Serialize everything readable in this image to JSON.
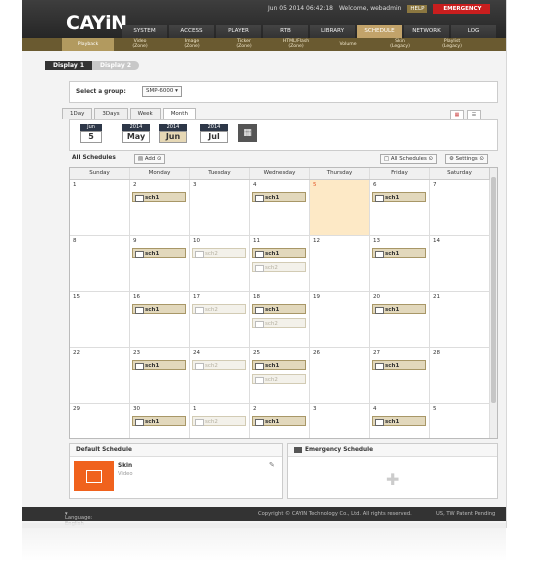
{
  "status": {
    "datetime": "Jun 05 2014 06:42:18",
    "welcome": "Welcome, webadmin",
    "help": "HELP",
    "emergency": "EMERGENCY"
  },
  "logo": "CAYiN",
  "main_nav": [
    "SYSTEM",
    "ACCESS",
    "PLAYER",
    "RTB",
    "LIBRARY",
    "SCHEDULE",
    "NETWORK",
    "LOG"
  ],
  "sub_nav": [
    {
      "line1": "Playback",
      "line2": ""
    },
    {
      "line1": "Video",
      "line2": "(Zone)"
    },
    {
      "line1": "Image",
      "line2": "(Zone)"
    },
    {
      "line1": "Ticker",
      "line2": "(Zone)"
    },
    {
      "line1": "HTML/Flash",
      "line2": "(Zone)"
    },
    {
      "line1": "Volume",
      "line2": ""
    },
    {
      "line1": "Skin",
      "line2": "(Legacy)"
    },
    {
      "line1": "Playlist",
      "line2": "(Legacy)"
    }
  ],
  "displays": [
    "Display 1",
    "Display 2"
  ],
  "group": {
    "label": "Select a group:",
    "value": "SMP-6000"
  },
  "view_tabs": [
    "1Day",
    "3Days",
    "Week",
    "Month"
  ],
  "date": {
    "month_label": "Jun",
    "day": "5",
    "years": [
      "2014",
      "2014",
      "2014"
    ],
    "months": [
      "May",
      "Jun",
      "Jul"
    ]
  },
  "schedules_bar": {
    "title": "All Schedules",
    "add": "Add",
    "all_schedules": "All Schedules",
    "settings": "Settings"
  },
  "weekdays": [
    "Sunday",
    "Monday",
    "Tuesday",
    "Wednesday",
    "Thursday",
    "Friday",
    "Saturday"
  ],
  "weeks": [
    [
      {
        "d": "1",
        "e": []
      },
      {
        "d": "2",
        "e": [
          {
            "n": "sch1",
            "dim": false
          }
        ]
      },
      {
        "d": "3",
        "e": []
      },
      {
        "d": "4",
        "e": [
          {
            "n": "sch1",
            "dim": false
          }
        ]
      },
      {
        "d": "5",
        "e": [],
        "today": true
      },
      {
        "d": "6",
        "e": [
          {
            "n": "sch1",
            "dim": false
          }
        ]
      },
      {
        "d": "7",
        "e": []
      }
    ],
    [
      {
        "d": "8",
        "e": []
      },
      {
        "d": "9",
        "e": [
          {
            "n": "sch1",
            "dim": false
          }
        ]
      },
      {
        "d": "10",
        "e": [
          {
            "n": "sch2",
            "dim": true
          }
        ]
      },
      {
        "d": "11",
        "e": [
          {
            "n": "sch1",
            "dim": false
          },
          {
            "n": "sch2",
            "dim": true
          }
        ]
      },
      {
        "d": "12",
        "e": []
      },
      {
        "d": "13",
        "e": [
          {
            "n": "sch1",
            "dim": false
          }
        ]
      },
      {
        "d": "14",
        "e": []
      }
    ],
    [
      {
        "d": "15",
        "e": []
      },
      {
        "d": "16",
        "e": [
          {
            "n": "sch1",
            "dim": false
          }
        ]
      },
      {
        "d": "17",
        "e": [
          {
            "n": "sch2",
            "dim": true
          }
        ]
      },
      {
        "d": "18",
        "e": [
          {
            "n": "sch1",
            "dim": false
          },
          {
            "n": "sch2",
            "dim": true
          }
        ]
      },
      {
        "d": "19",
        "e": []
      },
      {
        "d": "20",
        "e": [
          {
            "n": "sch1",
            "dim": false
          }
        ]
      },
      {
        "d": "21",
        "e": []
      }
    ],
    [
      {
        "d": "22",
        "e": []
      },
      {
        "d": "23",
        "e": [
          {
            "n": "sch1",
            "dim": false
          }
        ]
      },
      {
        "d": "24",
        "e": [
          {
            "n": "sch2",
            "dim": true
          }
        ]
      },
      {
        "d": "25",
        "e": [
          {
            "n": "sch1",
            "dim": false
          },
          {
            "n": "sch2",
            "dim": true
          }
        ]
      },
      {
        "d": "26",
        "e": []
      },
      {
        "d": "27",
        "e": [
          {
            "n": "sch1",
            "dim": false
          }
        ]
      },
      {
        "d": "28",
        "e": []
      }
    ],
    [
      {
        "d": "29",
        "e": []
      },
      {
        "d": "30",
        "e": [
          {
            "n": "sch1",
            "dim": false
          }
        ]
      },
      {
        "d": "1",
        "e": [
          {
            "n": "sch2",
            "dim": true
          }
        ]
      },
      {
        "d": "2",
        "e": [
          {
            "n": "sch1",
            "dim": false
          }
        ]
      },
      {
        "d": "3",
        "e": []
      },
      {
        "d": "4",
        "e": [
          {
            "n": "sch1",
            "dim": false
          }
        ]
      },
      {
        "d": "5",
        "e": []
      }
    ]
  ],
  "default_schedule": {
    "title": "Default Schedule",
    "name": "Skin",
    "type": "Video"
  },
  "emergency_schedule": {
    "title": "Emergency Schedule"
  },
  "footer": {
    "language": "Language:  English",
    "copyright": "Copyright © CAYIN Technology Co., Ltd. All rights reserved.",
    "patent": "US, TW Patent Pending"
  },
  "colors": {
    "accent": "#c2a36a",
    "subnav": "#6a5a30",
    "today": "#fde9c6",
    "emergency": "#c91e1e"
  }
}
